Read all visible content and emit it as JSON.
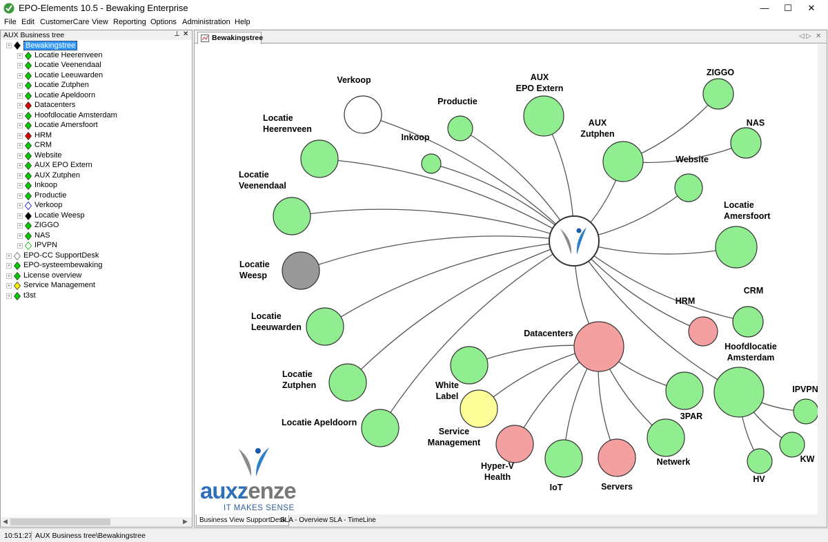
{
  "window": {
    "title": "EPO-Elements 10.5 - Bewaking Enterprise",
    "minimize": "—",
    "maximize": "☐",
    "close": "✕"
  },
  "menu": [
    "File",
    "Edit",
    "CustomerCare",
    "View",
    "Reporting",
    "Options",
    "Administration",
    "Help"
  ],
  "left_panel": {
    "title": "AUX Business tree",
    "pin": "⊥",
    "close": "✕",
    "tree": [
      {
        "label": "Bewakingstree",
        "level": 0,
        "color": "#000000",
        "selected": true
      },
      {
        "label": "Locatie Heerenveen",
        "level": 1,
        "color": "#00cc00"
      },
      {
        "label": "Locatie Veenendaal",
        "level": 1,
        "color": "#00cc00"
      },
      {
        "label": "Locatie Leeuwarden",
        "level": 1,
        "color": "#00cc00"
      },
      {
        "label": "Locatie Zutphen",
        "level": 1,
        "color": "#00cc00"
      },
      {
        "label": "Locatie Apeldoorn",
        "level": 1,
        "color": "#00cc00"
      },
      {
        "label": "Datacenters",
        "level": 1,
        "color": "#dd0000"
      },
      {
        "label": "Hoofdlocatie Amsterdam",
        "level": 1,
        "color": "#00cc00"
      },
      {
        "label": "Locatie Amersfoort",
        "level": 1,
        "color": "#00cc00"
      },
      {
        "label": "HRM",
        "level": 1,
        "color": "#dd0000"
      },
      {
        "label": "CRM",
        "level": 1,
        "color": "#00cc00"
      },
      {
        "label": "Website",
        "level": 1,
        "color": "#00cc00"
      },
      {
        "label": "AUX EPO Extern",
        "level": 1,
        "color": "#00cc00"
      },
      {
        "label": "AUX Zutphen",
        "level": 1,
        "color": "#00cc00"
      },
      {
        "label": "Inkoop",
        "level": 1,
        "color": "#00cc00"
      },
      {
        "label": "Productie",
        "level": 1,
        "color": "#00cc00"
      },
      {
        "label": "Verkoop",
        "level": 1,
        "color": "#ffffff",
        "border": "#0000cc"
      },
      {
        "label": "Locatie Weesp",
        "level": 1,
        "color": "#000000"
      },
      {
        "label": "ZIGGO",
        "level": 1,
        "color": "#00cc00"
      },
      {
        "label": "NAS",
        "level": 1,
        "color": "#00cc00"
      },
      {
        "label": "IPVPN",
        "level": 1,
        "color": "#ffffff",
        "border": "#00aa00"
      },
      {
        "label": "EPO-CC SupportDesk",
        "level": 0,
        "color": "#ffffff",
        "border": "#666666"
      },
      {
        "label": "EPO-systeembewaking",
        "level": 0,
        "color": "#00cc00"
      },
      {
        "label": "License overview",
        "level": 0,
        "color": "#00cc00"
      },
      {
        "label": "Service Management",
        "level": 0,
        "color": "#ffee00"
      },
      {
        "label": "t3st",
        "level": 0,
        "color": "#00cc00"
      }
    ]
  },
  "document_tab": {
    "label": "Bewakingstree"
  },
  "bottom_tabs": [
    "Business View SupportDesk",
    "SLA - Overview",
    "SLA - TimeLine"
  ],
  "logo": {
    "word": "auxzenze",
    "tagline": "IT MAKES SENSE"
  },
  "status": {
    "time": "10:51:27",
    "path": "AUX Business tree\\Bewakingstree"
  },
  "colors": {
    "ok": "#90ee90",
    "error": "#f4a0a0",
    "unknown": "#ffffff",
    "offline": "#999999",
    "warning": "#ffff99"
  },
  "graph": {
    "nodes": [
      {
        "id": "center",
        "label": [],
        "status": "center"
      },
      {
        "id": "verkoop",
        "label": [
          "Verkoop"
        ],
        "status": "unknown"
      },
      {
        "id": "productie",
        "label": [
          "Productie"
        ],
        "status": "ok"
      },
      {
        "id": "inkoop",
        "label": [
          "Inkoop"
        ],
        "status": "ok"
      },
      {
        "id": "aux-epo-extern",
        "label": [
          "AUX",
          "EPO Extern"
        ],
        "status": "ok"
      },
      {
        "id": "ziggo",
        "label": [
          "ZIGGO"
        ],
        "status": "ok"
      },
      {
        "id": "aux-zutphen",
        "label": [
          "AUX",
          "Zutphen"
        ],
        "status": "ok"
      },
      {
        "id": "nas",
        "label": [
          "NAS"
        ],
        "status": "ok"
      },
      {
        "id": "website",
        "label": [
          "Website"
        ],
        "status": "ok"
      },
      {
        "id": "locatie-amersfoort",
        "label": [
          "Locatie",
          "Amersfoort"
        ],
        "status": "ok"
      },
      {
        "id": "locatie-heerenveen",
        "label": [
          "Locatie",
          "Heerenveen"
        ],
        "status": "ok"
      },
      {
        "id": "locatie-veenendaal",
        "label": [
          "Locatie",
          "Veenendaal"
        ],
        "status": "ok"
      },
      {
        "id": "locatie-weesp",
        "label": [
          "Locatie",
          "Weesp"
        ],
        "status": "offline"
      },
      {
        "id": "locatie-leeuwarden",
        "label": [
          "Locatie",
          "Leeuwarden"
        ],
        "status": "ok"
      },
      {
        "id": "locatie-zutphen",
        "label": [
          "Locatie",
          "Zutphen"
        ],
        "status": "ok"
      },
      {
        "id": "locatie-apeldoorn",
        "label": [
          "Locatie Apeldoorn"
        ],
        "status": "ok"
      },
      {
        "id": "hrm",
        "label": [
          "HRM"
        ],
        "status": "error"
      },
      {
        "id": "crm",
        "label": [
          "CRM"
        ],
        "status": "ok"
      },
      {
        "id": "hoofdlocatie-amsterdam",
        "label": [
          "Hoofdlocatie",
          "Amsterdam"
        ],
        "status": "ok"
      },
      {
        "id": "datacenters",
        "label": [
          "Datacenters"
        ],
        "status": "error"
      },
      {
        "id": "white-label",
        "label": [
          "White",
          "Label"
        ],
        "status": "ok"
      },
      {
        "id": "service-management",
        "label": [
          "Service",
          "Management"
        ],
        "status": "warning"
      },
      {
        "id": "hyper-v-health",
        "label": [
          "Hyper-V",
          "Health"
        ],
        "status": "error"
      },
      {
        "id": "iot",
        "label": [
          "IoT"
        ],
        "status": "ok"
      },
      {
        "id": "servers",
        "label": [
          "Servers"
        ],
        "status": "error"
      },
      {
        "id": "netwerk",
        "label": [
          "Netwerk"
        ],
        "status": "ok"
      },
      {
        "id": "3par",
        "label": [
          "3PAR"
        ],
        "status": "ok"
      },
      {
        "id": "ipvpn",
        "label": [
          "IPVPN"
        ],
        "status": "ok"
      },
      {
        "id": "kw",
        "label": [
          "KW"
        ],
        "status": "ok"
      },
      {
        "id": "hv",
        "label": [
          "HV"
        ],
        "status": "ok"
      }
    ],
    "edges": [
      [
        "center",
        "verkoop"
      ],
      [
        "center",
        "productie"
      ],
      [
        "center",
        "inkoop"
      ],
      [
        "center",
        "aux-epo-extern"
      ],
      [
        "center",
        "aux-zutphen"
      ],
      [
        "center",
        "website"
      ],
      [
        "center",
        "locatie-amersfoort"
      ],
      [
        "center",
        "locatie-heerenveen"
      ],
      [
        "center",
        "locatie-veenendaal"
      ],
      [
        "center",
        "locatie-weesp"
      ],
      [
        "center",
        "locatie-leeuwarden"
      ],
      [
        "center",
        "locatie-zutphen"
      ],
      [
        "center",
        "locatie-apeldoorn"
      ],
      [
        "center",
        "hrm"
      ],
      [
        "center",
        "crm"
      ],
      [
        "center",
        "hoofdlocatie-amsterdam"
      ],
      [
        "center",
        "datacenters"
      ],
      [
        "aux-zutphen",
        "ziggo"
      ],
      [
        "aux-zutphen",
        "nas"
      ],
      [
        "datacenters",
        "white-label"
      ],
      [
        "datacenters",
        "service-management"
      ],
      [
        "datacenters",
        "hyper-v-health"
      ],
      [
        "datacenters",
        "iot"
      ],
      [
        "datacenters",
        "servers"
      ],
      [
        "datacenters",
        "netwerk"
      ],
      [
        "datacenters",
        "3par"
      ],
      [
        "hoofdlocatie-amsterdam",
        "ipvpn"
      ],
      [
        "hoofdlocatie-amsterdam",
        "kw"
      ],
      [
        "hoofdlocatie-amsterdam",
        "hv"
      ]
    ]
  }
}
